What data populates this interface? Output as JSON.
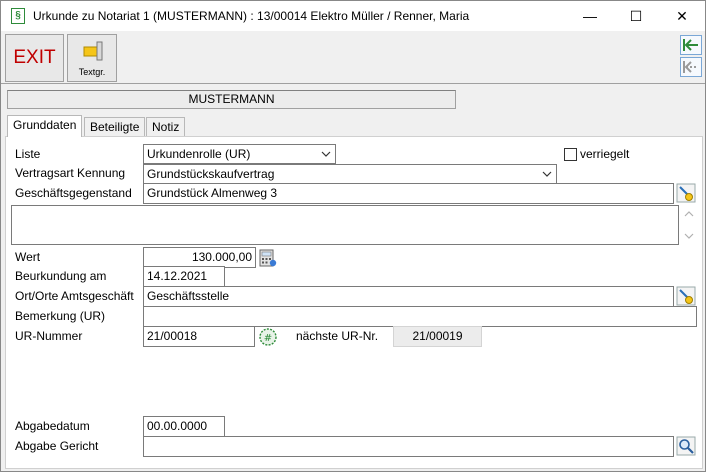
{
  "window": {
    "title": "Urkunde zu Notariat 1 (MUSTERMANN) : 13/00014  Elektro Müller / Renner, Maria",
    "app_icon_glyph": "§",
    "minimize_glyph": "—",
    "maximize_glyph": "☐",
    "close_glyph": "✕"
  },
  "toolbar": {
    "exit_label": "EXIT",
    "textgr_label": "Textgr.",
    "nav_first_icon": "arrow-left-bar-icon",
    "nav_prev_icon": "arrow-left-dashed-icon"
  },
  "header": {
    "name": "MUSTERMANN"
  },
  "tabs": [
    {
      "label": "Grunddaten",
      "active": true
    },
    {
      "label": "Beteiligte",
      "active": false
    },
    {
      "label": "Notiz",
      "active": false
    }
  ],
  "form": {
    "liste": {
      "label": "Liste",
      "value": "Urkundenrolle (UR)"
    },
    "verriegelt": {
      "label": "verriegelt",
      "checked": false
    },
    "vertragsart": {
      "label": "Vertragsart Kennung",
      "value": "Grundstückskaufvertrag"
    },
    "geschaeftsgegenstand": {
      "label": "Geschäftsgegenstand",
      "value": "Grundstück Almenweg 3"
    },
    "wert": {
      "label": "Wert",
      "value": "130.000,00"
    },
    "beurkundung": {
      "label": "Beurkundung am",
      "value": "14.12.2021"
    },
    "ort": {
      "label": "Ort/Orte Amtsgeschäft",
      "value": "Geschäftsstelle"
    },
    "bemerkung": {
      "label": "Bemerkung (UR)",
      "value": ""
    },
    "ur_nummer": {
      "label": "UR-Nummer",
      "value": "21/00018"
    },
    "naechste_ur": {
      "label": "nächste UR-Nr.",
      "value": "21/00019"
    },
    "abgabedatum": {
      "label": "Abgabedatum",
      "value": "00.00.0000"
    },
    "abgabe_gericht": {
      "label": "Abgabe Gericht",
      "value": ""
    }
  },
  "colors": {
    "exit_red": "#c00000",
    "accent_green": "#2e8b3a",
    "nav_blue": "#7aa7d6"
  }
}
